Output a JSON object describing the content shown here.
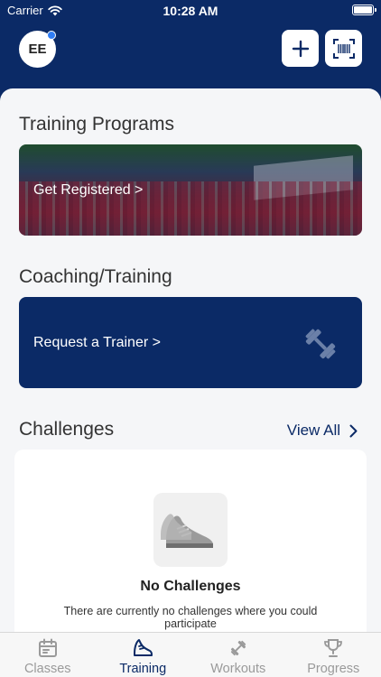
{
  "status_bar": {
    "carrier": "Carrier",
    "time": "10:28 AM"
  },
  "header": {
    "avatar_initials": "EE"
  },
  "training_programs": {
    "title": "Training Programs",
    "card_label": "Get Registered >"
  },
  "coaching": {
    "title": "Coaching/Training",
    "card_label": "Request a Trainer >"
  },
  "challenges": {
    "title": "Challenges",
    "view_all": "View All",
    "empty_title": "No Challenges",
    "empty_description": "There are currently no challenges where you could participate"
  },
  "tabs": [
    {
      "label": "Classes",
      "icon": "calendar-icon",
      "active": false
    },
    {
      "label": "Training",
      "icon": "running-shoe-icon",
      "active": true
    },
    {
      "label": "Workouts",
      "icon": "dumbbell-icon",
      "active": false
    },
    {
      "label": "Progress",
      "icon": "trophy-icon",
      "active": false
    }
  ],
  "colors": {
    "primary": "#0b2a66",
    "background": "#f5f6f8",
    "inactive_tab": "#9a9a9a",
    "notification_dot": "#2f7df6"
  }
}
